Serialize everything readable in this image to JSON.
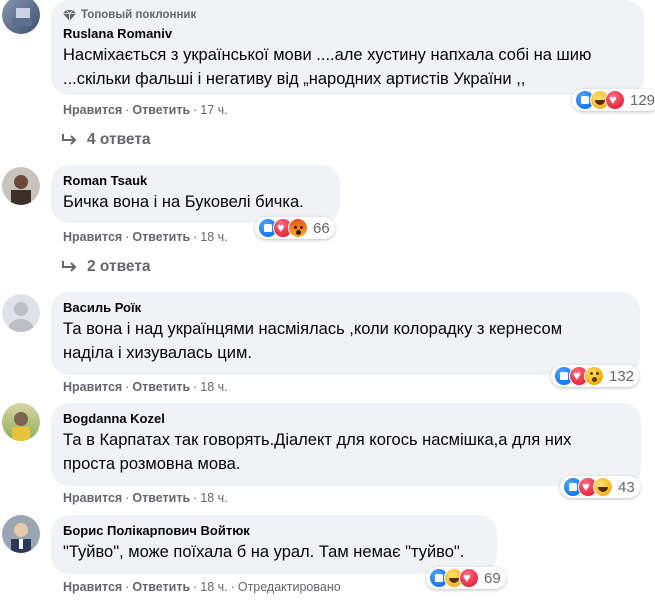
{
  "comments": [
    {
      "badge": "Топовый поклонник",
      "author": "Ruslana Romaniv",
      "lines": [
        "Насміхається з української мови ....але хустину напхала собі на шию",
        "...скільки фальші і негативу від „народних артистів України ,,"
      ],
      "like": "Нравится",
      "reply": "Ответить",
      "time": "17 ч.",
      "reactions": [
        "like",
        "haha",
        "love"
      ],
      "reaction_count": "129",
      "replies": "4 ответа"
    },
    {
      "author": "Roman Tsauk",
      "lines": [
        "Бичка вона і на Буковелі бичка."
      ],
      "like": "Нравится",
      "reply": "Ответить",
      "time": "18 ч.",
      "reactions": [
        "like",
        "love",
        "angry"
      ],
      "reaction_count": "66",
      "replies": "2 ответа"
    },
    {
      "author": "Василь Роїк",
      "lines": [
        "Та вона і над українцями насміялась ,коли колорадку з кернесом",
        "наділа і хизувалась цим."
      ],
      "like": "Нравится",
      "reply": "Ответить",
      "time": "18 ч.",
      "reactions": [
        "like",
        "love",
        "sad"
      ],
      "reaction_count": "132"
    },
    {
      "author": "Bogdanna Kozel",
      "lines": [
        "Та в Карпатах так говорять.Діалект для когось насмішка,а для них",
        "проста розмовна мова."
      ],
      "like": "Нравится",
      "reply": "Ответить",
      "time": "18 ч.",
      "reactions": [
        "like",
        "love",
        "haha"
      ],
      "reaction_count": "43"
    },
    {
      "author": "Борис Полікарпович Войтюк",
      "lines": [
        "\"Туйво\", може поїхала б на урал. Там немає \"туйво\"."
      ],
      "like": "Нравится",
      "reply": "Ответить",
      "time": "18 ч.",
      "edited": "Отредактировано",
      "reactions": [
        "like",
        "haha",
        "love"
      ],
      "reaction_count": "69"
    }
  ],
  "colors": {
    "bubble": "#f0f2f5",
    "meta": "#65676b",
    "text": "#050505"
  }
}
